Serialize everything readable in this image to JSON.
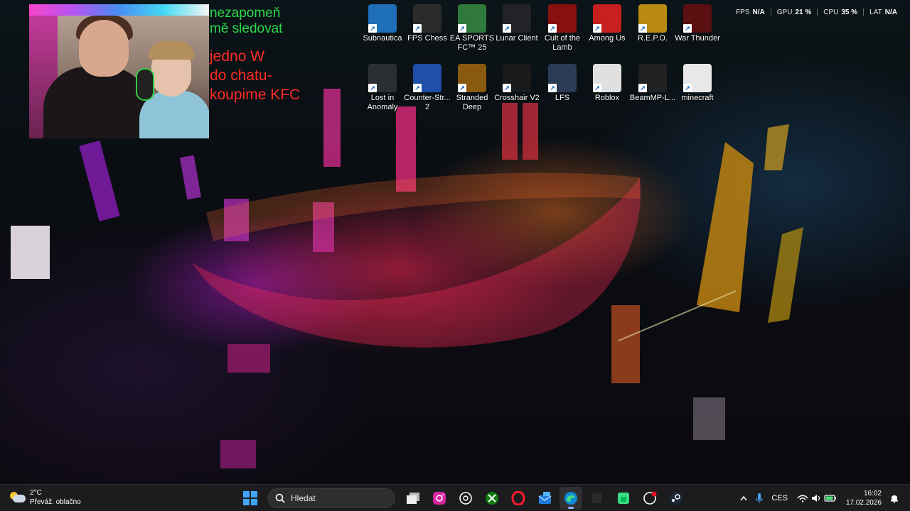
{
  "overlay": {
    "follow_text": [
      "nezapomeň",
      "mě sledovat"
    ],
    "chat_text": [
      "jedno W",
      "do chatu-",
      "koupime KFC"
    ]
  },
  "perf": [
    {
      "key": "FPS",
      "value": "N/A"
    },
    {
      "key": "GPU",
      "value": "21 %"
    },
    {
      "key": "CPU",
      "value": "35 %"
    },
    {
      "key": "LAT",
      "value": "N/A"
    }
  ],
  "desktop_icons": [
    {
      "label": "Subnautica",
      "icon": "subnautica-icon",
      "color": "#1f6fb8"
    },
    {
      "label": "FPS Chess",
      "icon": "fps-chess-icon",
      "color": "#2b2b2b"
    },
    {
      "label": "EA SPORTS FC™ 25",
      "icon": "ea-fc25-icon",
      "color": "#2f7a3a"
    },
    {
      "label": "Lunar Client",
      "icon": "lunar-client-icon",
      "color": "#222428"
    },
    {
      "label": "Cult of the Lamb",
      "icon": "cult-of-the-lamb-icon",
      "color": "#8a1010"
    },
    {
      "label": "Among Us",
      "icon": "among-us-icon",
      "color": "#c81f1f"
    },
    {
      "label": "R.E.P.O.",
      "icon": "repo-icon",
      "color": "#b88a10"
    },
    {
      "label": "War Thunder",
      "icon": "war-thunder-icon",
      "color": "#5a1010"
    },
    {
      "label": "Lost in Anomaly",
      "icon": "lost-in-anomaly-icon",
      "color": "#2b2e33"
    },
    {
      "label": "Counter-Str... 2",
      "icon": "counter-strike-icon",
      "color": "#1f4fa8"
    },
    {
      "label": "Stranded Deep",
      "icon": "stranded-deep-icon",
      "color": "#8a5a10"
    },
    {
      "label": "Crosshair V2",
      "icon": "crosshair-icon",
      "color": "#1a1a1a"
    },
    {
      "label": "LFS",
      "icon": "lfs-icon",
      "color": "#2b3a55"
    },
    {
      "label": "Roblox",
      "icon": "roblox-icon",
      "color": "#e0e0e0"
    },
    {
      "label": "BeamMP-L...",
      "icon": "beammp-icon",
      "color": "#222"
    },
    {
      "label": "minecraft",
      "icon": "minecraft-icon",
      "color": "#e8e8e8"
    }
  ],
  "taskbar": {
    "weather_temp": "2°C",
    "weather_desc": "Převáž. oblačno",
    "search_placeholder": "Hledat",
    "language": "CES",
    "time": "16:02",
    "date": "17.02.2026"
  }
}
